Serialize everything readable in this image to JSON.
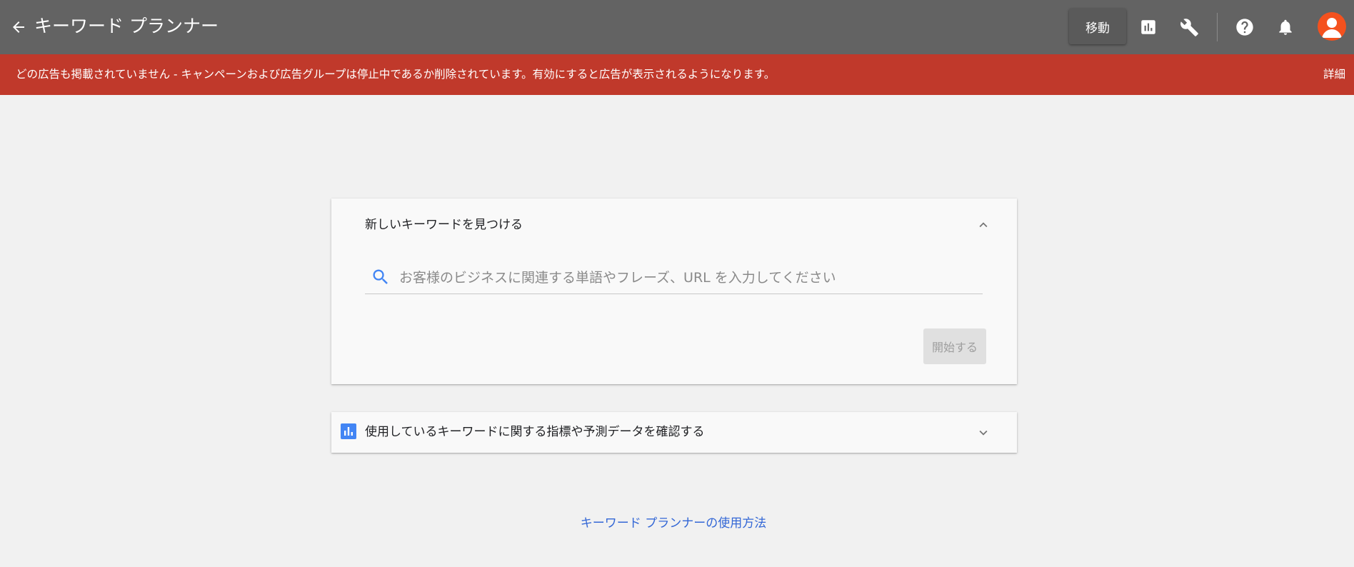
{
  "header": {
    "title": "キーワード プランナー",
    "move_label": "移動",
    "icons": [
      "back-arrow-icon",
      "reports-icon",
      "tools-icon",
      "help-icon",
      "notifications-icon",
      "account-avatar"
    ]
  },
  "alert": {
    "message": "どの広告も掲載されていません - キャンペーンおよび広告グループは停止中であるか削除されています。有効にすると広告が表示されるようになります。",
    "link_label": "詳細",
    "color": "#c0392b"
  },
  "discover_card": {
    "title": "新しいキーワードを見つける",
    "search_placeholder": "お客様のビジネスに関連する単語やフレーズ、URL を入力してください",
    "search_value": "",
    "start_label": "開始する"
  },
  "metrics_card": {
    "title": "使用しているキーワードに関する指標や予測データを確認する"
  },
  "footer": {
    "help_link": "キーワード プランナーの使用方法"
  },
  "colors": {
    "header_bg": "#636363",
    "page_bg": "#f1f1f1",
    "accent": "#4285f4",
    "link": "#3367d6",
    "avatar": "#f4511e"
  }
}
